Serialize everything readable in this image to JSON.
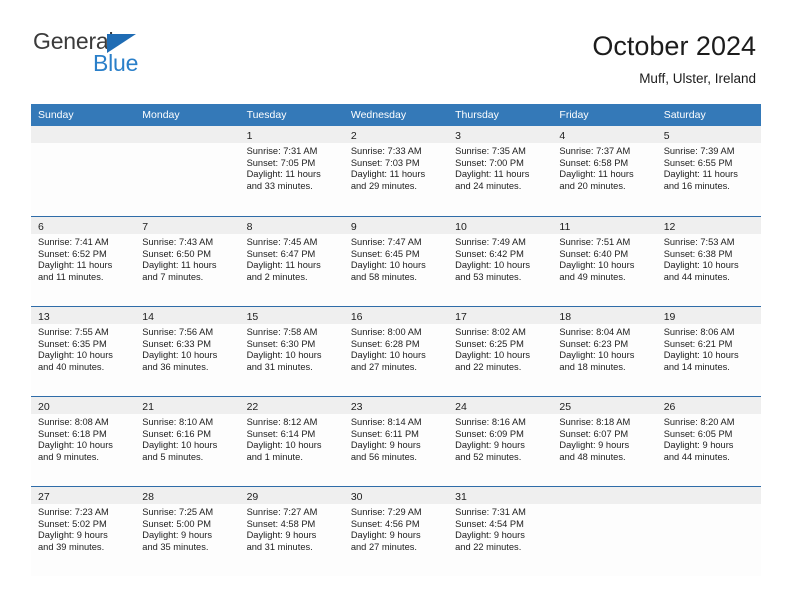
{
  "brand": {
    "name_top": "General",
    "name_bottom": "Blue",
    "triangle_color": "#1f6cb4",
    "text_color": "#3b3b3b",
    "blue_color": "#2a7fc9"
  },
  "header": {
    "title": "October 2024",
    "subtitle": "Muff, Ulster, Ireland"
  },
  "colors": {
    "header_row_bg": "#3479b8",
    "header_row_text": "#ffffff",
    "week_divider": "#2f6ca8",
    "date_band_bg": "#efefef",
    "cell_bg": "#fdfdfd",
    "body_text": "#1d1d1d"
  },
  "weekdays": [
    "Sunday",
    "Monday",
    "Tuesday",
    "Wednesday",
    "Thursday",
    "Friday",
    "Saturday"
  ],
  "weeks": [
    [
      {
        "empty": true
      },
      {
        "empty": true
      },
      {
        "day": "1",
        "sunrise": "Sunrise: 7:31 AM",
        "sunset": "Sunset: 7:05 PM",
        "daylight_1": "Daylight: 11 hours",
        "daylight_2": "and 33 minutes."
      },
      {
        "day": "2",
        "sunrise": "Sunrise: 7:33 AM",
        "sunset": "Sunset: 7:03 PM",
        "daylight_1": "Daylight: 11 hours",
        "daylight_2": "and 29 minutes."
      },
      {
        "day": "3",
        "sunrise": "Sunrise: 7:35 AM",
        "sunset": "Sunset: 7:00 PM",
        "daylight_1": "Daylight: 11 hours",
        "daylight_2": "and 24 minutes."
      },
      {
        "day": "4",
        "sunrise": "Sunrise: 7:37 AM",
        "sunset": "Sunset: 6:58 PM",
        "daylight_1": "Daylight: 11 hours",
        "daylight_2": "and 20 minutes."
      },
      {
        "day": "5",
        "sunrise": "Sunrise: 7:39 AM",
        "sunset": "Sunset: 6:55 PM",
        "daylight_1": "Daylight: 11 hours",
        "daylight_2": "and 16 minutes."
      }
    ],
    [
      {
        "day": "6",
        "sunrise": "Sunrise: 7:41 AM",
        "sunset": "Sunset: 6:52 PM",
        "daylight_1": "Daylight: 11 hours",
        "daylight_2": "and 11 minutes."
      },
      {
        "day": "7",
        "sunrise": "Sunrise: 7:43 AM",
        "sunset": "Sunset: 6:50 PM",
        "daylight_1": "Daylight: 11 hours",
        "daylight_2": "and 7 minutes."
      },
      {
        "day": "8",
        "sunrise": "Sunrise: 7:45 AM",
        "sunset": "Sunset: 6:47 PM",
        "daylight_1": "Daylight: 11 hours",
        "daylight_2": "and 2 minutes."
      },
      {
        "day": "9",
        "sunrise": "Sunrise: 7:47 AM",
        "sunset": "Sunset: 6:45 PM",
        "daylight_1": "Daylight: 10 hours",
        "daylight_2": "and 58 minutes."
      },
      {
        "day": "10",
        "sunrise": "Sunrise: 7:49 AM",
        "sunset": "Sunset: 6:42 PM",
        "daylight_1": "Daylight: 10 hours",
        "daylight_2": "and 53 minutes."
      },
      {
        "day": "11",
        "sunrise": "Sunrise: 7:51 AM",
        "sunset": "Sunset: 6:40 PM",
        "daylight_1": "Daylight: 10 hours",
        "daylight_2": "and 49 minutes."
      },
      {
        "day": "12",
        "sunrise": "Sunrise: 7:53 AM",
        "sunset": "Sunset: 6:38 PM",
        "daylight_1": "Daylight: 10 hours",
        "daylight_2": "and 44 minutes."
      }
    ],
    [
      {
        "day": "13",
        "sunrise": "Sunrise: 7:55 AM",
        "sunset": "Sunset: 6:35 PM",
        "daylight_1": "Daylight: 10 hours",
        "daylight_2": "and 40 minutes."
      },
      {
        "day": "14",
        "sunrise": "Sunrise: 7:56 AM",
        "sunset": "Sunset: 6:33 PM",
        "daylight_1": "Daylight: 10 hours",
        "daylight_2": "and 36 minutes."
      },
      {
        "day": "15",
        "sunrise": "Sunrise: 7:58 AM",
        "sunset": "Sunset: 6:30 PM",
        "daylight_1": "Daylight: 10 hours",
        "daylight_2": "and 31 minutes."
      },
      {
        "day": "16",
        "sunrise": "Sunrise: 8:00 AM",
        "sunset": "Sunset: 6:28 PM",
        "daylight_1": "Daylight: 10 hours",
        "daylight_2": "and 27 minutes."
      },
      {
        "day": "17",
        "sunrise": "Sunrise: 8:02 AM",
        "sunset": "Sunset: 6:25 PM",
        "daylight_1": "Daylight: 10 hours",
        "daylight_2": "and 22 minutes."
      },
      {
        "day": "18",
        "sunrise": "Sunrise: 8:04 AM",
        "sunset": "Sunset: 6:23 PM",
        "daylight_1": "Daylight: 10 hours",
        "daylight_2": "and 18 minutes."
      },
      {
        "day": "19",
        "sunrise": "Sunrise: 8:06 AM",
        "sunset": "Sunset: 6:21 PM",
        "daylight_1": "Daylight: 10 hours",
        "daylight_2": "and 14 minutes."
      }
    ],
    [
      {
        "day": "20",
        "sunrise": "Sunrise: 8:08 AM",
        "sunset": "Sunset: 6:18 PM",
        "daylight_1": "Daylight: 10 hours",
        "daylight_2": "and 9 minutes."
      },
      {
        "day": "21",
        "sunrise": "Sunrise: 8:10 AM",
        "sunset": "Sunset: 6:16 PM",
        "daylight_1": "Daylight: 10 hours",
        "daylight_2": "and 5 minutes."
      },
      {
        "day": "22",
        "sunrise": "Sunrise: 8:12 AM",
        "sunset": "Sunset: 6:14 PM",
        "daylight_1": "Daylight: 10 hours",
        "daylight_2": "and 1 minute."
      },
      {
        "day": "23",
        "sunrise": "Sunrise: 8:14 AM",
        "sunset": "Sunset: 6:11 PM",
        "daylight_1": "Daylight: 9 hours",
        "daylight_2": "and 56 minutes."
      },
      {
        "day": "24",
        "sunrise": "Sunrise: 8:16 AM",
        "sunset": "Sunset: 6:09 PM",
        "daylight_1": "Daylight: 9 hours",
        "daylight_2": "and 52 minutes."
      },
      {
        "day": "25",
        "sunrise": "Sunrise: 8:18 AM",
        "sunset": "Sunset: 6:07 PM",
        "daylight_1": "Daylight: 9 hours",
        "daylight_2": "and 48 minutes."
      },
      {
        "day": "26",
        "sunrise": "Sunrise: 8:20 AM",
        "sunset": "Sunset: 6:05 PM",
        "daylight_1": "Daylight: 9 hours",
        "daylight_2": "and 44 minutes."
      }
    ],
    [
      {
        "day": "27",
        "sunrise": "Sunrise: 7:23 AM",
        "sunset": "Sunset: 5:02 PM",
        "daylight_1": "Daylight: 9 hours",
        "daylight_2": "and 39 minutes."
      },
      {
        "day": "28",
        "sunrise": "Sunrise: 7:25 AM",
        "sunset": "Sunset: 5:00 PM",
        "daylight_1": "Daylight: 9 hours",
        "daylight_2": "and 35 minutes."
      },
      {
        "day": "29",
        "sunrise": "Sunrise: 7:27 AM",
        "sunset": "Sunset: 4:58 PM",
        "daylight_1": "Daylight: 9 hours",
        "daylight_2": "and 31 minutes."
      },
      {
        "day": "30",
        "sunrise": "Sunrise: 7:29 AM",
        "sunset": "Sunset: 4:56 PM",
        "daylight_1": "Daylight: 9 hours",
        "daylight_2": "and 27 minutes."
      },
      {
        "day": "31",
        "sunrise": "Sunrise: 7:31 AM",
        "sunset": "Sunset: 4:54 PM",
        "daylight_1": "Daylight: 9 hours",
        "daylight_2": "and 22 minutes."
      },
      {
        "empty": true
      },
      {
        "empty": true
      }
    ]
  ]
}
